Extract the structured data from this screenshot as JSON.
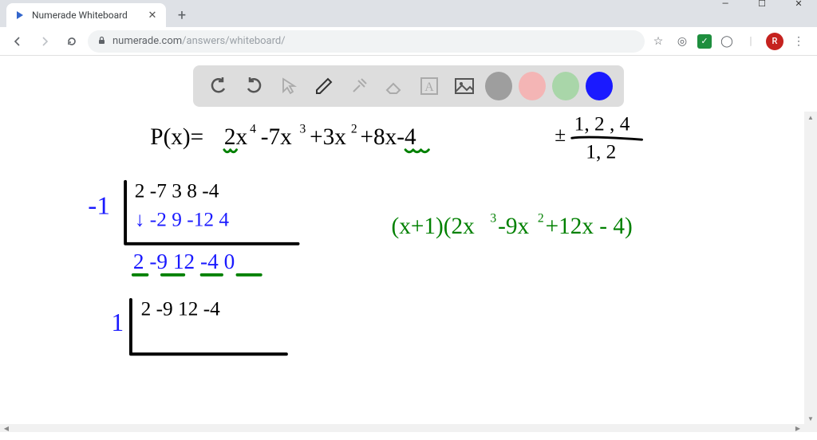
{
  "window": {
    "minimize_label": "—",
    "maximize_label": "☐",
    "close_label": "✕"
  },
  "browser": {
    "tab": {
      "title": "Numerade Whiteboard",
      "close_glyph": "✕"
    },
    "newtab_glyph": "+",
    "nav": {
      "back": "←",
      "forward": "→",
      "reload": "⟳"
    },
    "url": {
      "lock": "🔒",
      "host": "numerade.com",
      "path": "/answers/whiteboard/"
    },
    "toolbar_right": {
      "star": "☆",
      "ext1": "◎",
      "check": "✓",
      "ext2": "◯",
      "avatar_letter": "R",
      "menu": "⋮"
    }
  },
  "whiteboard_toolbar": {
    "undo": "undo-icon",
    "redo": "redo-icon",
    "select": "select-icon",
    "pen": "pen-icon",
    "tools": "tools-icon",
    "eraser": "eraser-icon",
    "text": "text-icon",
    "image": "image-icon",
    "colors": {
      "gray": "#9e9e9e",
      "pink": "#f4b5b5",
      "green": "#a9d6a9",
      "blue": "#1a1aff"
    },
    "active_color": "blue"
  },
  "handwriting": {
    "polynomial": "P(x) = 2x^4 - 7x^3 + 3x^2 + 8x - 4",
    "possible_roots": "± (1,2,4) / (1,2)",
    "synthetic1": {
      "divisor": "-1",
      "row1": "2  -7  3  8  -4",
      "row2": "↓  -2  9  -12  4",
      "result": "2  -9  12  -4  0"
    },
    "factored": "(x+1)(2x^3 - 9x^2 + 12x - 4)",
    "synthetic2": {
      "divisor": "1",
      "row1": "2  -9  12  -4"
    }
  },
  "colors": {
    "ink_black": "#000000",
    "ink_blue": "#1a1aff",
    "ink_green": "#008000"
  }
}
